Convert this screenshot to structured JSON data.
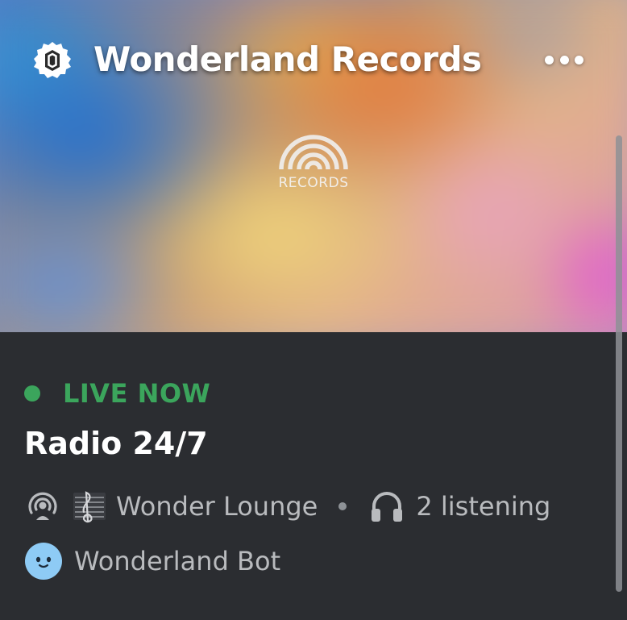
{
  "server": {
    "name": "Wonderland Records",
    "icon": "server-badge-icon",
    "more_icon": "more-options-icon"
  },
  "banner": {
    "logo_icon": "rainbow-arc-icon",
    "logo_text": "RECORDS"
  },
  "event": {
    "status_label": "LIVE NOW",
    "status_color": "#3ba55c",
    "title": "Radio 24/7",
    "stage_icon": "stage-channel-icon",
    "channel_emoji_icon": "treble-clef-sheet-icon",
    "channel_name": "Wonder Lounge",
    "listeners_icon": "headphones-icon",
    "listening_text": "2 listening",
    "host_avatar_icon": "bot-avatar-icon",
    "host_name": "Wonderland Bot"
  },
  "colors": {
    "panel_background": "#2b2d31",
    "primary_text": "#ffffff",
    "secondary_text": "#b9bbbe",
    "live_green": "#3ba55c",
    "avatar_blue": "#8ecbf5"
  }
}
